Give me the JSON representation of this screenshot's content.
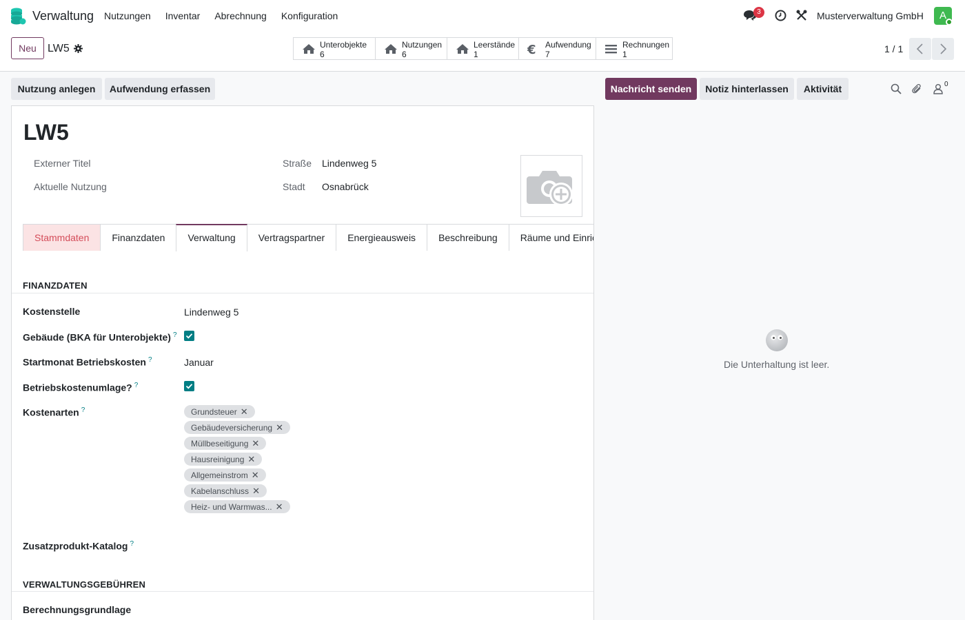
{
  "nav": {
    "app_name": "Verwaltung",
    "menu": [
      "Nutzungen",
      "Inventar",
      "Abrechnung",
      "Konfiguration"
    ],
    "chat_badge": "3",
    "company": "Musterverwaltung GmbH",
    "avatar_letter": "A"
  },
  "control": {
    "new_label": "Neu",
    "record_name": "LW5",
    "smart_buttons": [
      {
        "label": "Unterobjekte",
        "count": "6",
        "icon": "home-icon"
      },
      {
        "label": "Nutzungen",
        "count": "6",
        "icon": "home-icon"
      },
      {
        "label": "Leerstände",
        "count": "1",
        "icon": "home-icon"
      },
      {
        "label": "Aufwendung",
        "count": "7",
        "icon": "euro-icon"
      },
      {
        "label": "Rechnungen",
        "count": "1",
        "icon": "list-icon"
      }
    ],
    "pager": "1 / 1"
  },
  "actions": {
    "create_usage": "Nutzung anlegen",
    "record_expense": "Aufwendung erfassen",
    "send_message": "Nachricht senden",
    "log_note": "Notiz hinterlassen",
    "activity": "Aktivität",
    "followers": "0"
  },
  "form": {
    "title": "LW5",
    "external_title_label": "Externer Titel",
    "current_usage_label": "Aktuelle Nutzung",
    "street_label": "Straße",
    "street_value": "Lindenweg 5",
    "city_label": "Stadt",
    "city_value": "Osnabrück",
    "tabs": [
      "Stammdaten",
      "Finanzdaten",
      "Verwaltung",
      "Vertragspartner",
      "Energieausweis",
      "Beschreibung",
      "Räume und Einrichtung"
    ],
    "section_finance": "FINANZDATEN",
    "cost_center_label": "Kostenstelle",
    "cost_center_value": "Lindenweg 5",
    "building_label": "Gebäude (BKA für Unterobjekte)",
    "start_month_label": "Startmonat Betriebskosten",
    "start_month_value": "Januar",
    "apportionment_label": "Betriebskostenumlage?",
    "cost_types_label": "Kostenarten",
    "cost_types": [
      "Grundsteuer",
      "Gebäudeversicherung",
      "Müllbeseitigung",
      "Hausreinigung",
      "Allgemeinstrom",
      "Kabelanschluss",
      "Heiz- und Warmwas..."
    ],
    "catalog_label": "Zusatzprodukt-Katalog",
    "section_fees": "VERWALTUNGSGEBÜHREN",
    "basis_label": "Berechnungsgrundlage",
    "help_mark": "?"
  },
  "chatter": {
    "empty_text": "Die Unterhaltung ist leer."
  },
  "colors": {
    "brand": "#71395f",
    "check": "#017e84",
    "error_tab": "#fbe3e4"
  }
}
